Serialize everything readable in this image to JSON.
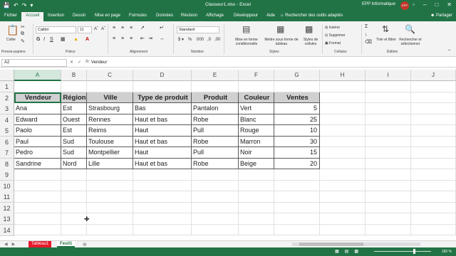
{
  "titlebar": {
    "qat_icons": [
      "save-icon",
      "undo-icon",
      "redo-icon",
      "customize-icon"
    ],
    "doc_title": "Classeur1.xlsx - Excel",
    "user": "EPP Informatique",
    "avatar_text": "EPP",
    "window_buttons": [
      "–",
      "□",
      "✕"
    ]
  },
  "tabs": {
    "fichier": "Fichier",
    "accueil": "Accueil",
    "insertion": "Insertion",
    "dessin": "Dessin",
    "mise_en_page": "Mise en page",
    "formules": "Formules",
    "donnees": "Données",
    "revision": "Révision",
    "affichage": "Affichage",
    "developpeur": "Développeur",
    "aide": "Aide",
    "tell_me": "Rechercher des outils adaptés",
    "share": "Partager"
  },
  "ribbon": {
    "paste": "Coller",
    "clipboard_group": "Presse-papiers",
    "font_name": "Calibri",
    "font_size": "11",
    "font_group": "Police",
    "alignment_group": "Alignement",
    "number_format": "Standard",
    "number_group": "Nombre",
    "cond_format": "Mise en forme conditionnelle",
    "format_table": "Mettre sous forme de tableau",
    "cell_styles": "Styles de cellules",
    "styles_group": "Styles",
    "insert": "Insérer",
    "delete": "Supprimer",
    "format": "Format",
    "cells_group": "Cellules",
    "sort_filter": "Trier et filtrer",
    "find_select": "Rechercher et sélectionner",
    "editing_group": "Édition"
  },
  "formula_bar": {
    "name_box": "A2",
    "content": "Vendeur"
  },
  "columns": [
    "A",
    "B",
    "C",
    "D",
    "E",
    "F",
    "G",
    "H",
    "I",
    "J"
  ],
  "rows": [
    "1",
    "2",
    "3",
    "4",
    "5",
    "6",
    "7",
    "8",
    "9",
    "10",
    "11",
    "12",
    "13",
    "14"
  ],
  "table": {
    "headers": [
      "Vendeur",
      "Région",
      "Ville",
      "Type de produit",
      "Produit",
      "Couleur",
      "Ventes"
    ],
    "rows": [
      [
        "Ana",
        "Est",
        "Strasbourg",
        "Bas",
        "Pantalon",
        "Vert",
        "5"
      ],
      [
        "Edward",
        "Ouest",
        "Rennes",
        "Haut et bas",
        "Robe",
        "Blanc",
        "25"
      ],
      [
        "Paolo",
        "Est",
        "Reims",
        "Haut",
        "Pull",
        "Rouge",
        "10"
      ],
      [
        "Paul",
        "Sud",
        "Toulouse",
        "Haut et bas",
        "Robe",
        "Marron",
        "30"
      ],
      [
        "Pedro",
        "Sud",
        "Montpellier",
        "Haut",
        "Pull",
        "Noir",
        "15"
      ],
      [
        "Sandrine",
        "Nord",
        "Lille",
        "Haut et bas",
        "Robe",
        "Beige",
        "20"
      ]
    ]
  },
  "sheets": {
    "tab1": "Tableau1",
    "tab2": "Feuil1"
  },
  "status": {
    "zoom": "160 %"
  }
}
